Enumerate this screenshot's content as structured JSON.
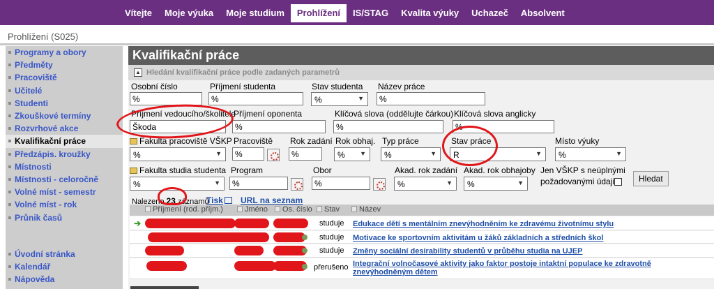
{
  "topnav": {
    "tabs": [
      "Vítejte",
      "Moje výuka",
      "Moje studium",
      "Prohlížení",
      "IS/STAG",
      "Kvalita výuky",
      "Uchazeč",
      "Absolvent"
    ],
    "active_index": 3
  },
  "page": {
    "title": "Prohlížení (S025)"
  },
  "sidebar": {
    "items": [
      "Programy a obory",
      "Předměty",
      "Pracoviště",
      "Učitelé",
      "Studenti",
      "Zkouškové termíny",
      "Rozvrhové akce",
      "Kvalifikační práce",
      "Předzápis. kroužky",
      "Místnosti",
      "Místnosti - celoročně",
      "Volné míst - semestr",
      "Volné míst - rok",
      "Průnik časů"
    ],
    "items_bottom": [
      "Úvodní stránka",
      "Kalendář",
      "Nápověda"
    ],
    "active_index": 7
  },
  "main": {
    "heading": "Kvalifikační práce",
    "subheading": "Hledání kvalifikační práce podle zadaných parametrů"
  },
  "form": {
    "osobni_cislo": {
      "label": "Osobní číslo",
      "value": "%"
    },
    "prijmeni_studenta": {
      "label": "Příjmení studenta",
      "value": "%"
    },
    "stav_studenta": {
      "label": "Stav studenta",
      "value": "%"
    },
    "nazev_prace": {
      "label": "Název práce",
      "value": "%"
    },
    "prijmeni_vedouciho": {
      "label": "Příjmení vedoucího/školitele",
      "value": "Škoda"
    },
    "prijmeni_oponenta": {
      "label": "Příjmení oponenta",
      "value": "%"
    },
    "klicova_slova": {
      "label": "Klíčová slova (oddělujte čárkou)",
      "value": "%"
    },
    "klicova_slova_en": {
      "label": "Klíčová slova anglicky",
      "value": "%"
    },
    "fakulta_pracoviste": {
      "label": "Fakulta pracoviště VŠKP",
      "value": "%"
    },
    "pracoviste": {
      "label": "Pracoviště",
      "value": "%"
    },
    "rok_zadani": {
      "label": "Rok zadání",
      "value": "%"
    },
    "rok_obhaj": {
      "label": "Rok obhaj.",
      "value": "%"
    },
    "typ_prace": {
      "label": "Typ práce",
      "value": "%"
    },
    "stav_prace": {
      "label": "Stav práce",
      "value": "R"
    },
    "misto_vyuky": {
      "label": "Místo výuky",
      "value": "%"
    },
    "fakulta_studia": {
      "label": "Fakulta studia studenta",
      "value": "%"
    },
    "program": {
      "label": "Program",
      "value": "%"
    },
    "obor": {
      "label": "Obor",
      "value": "%"
    },
    "akad_rok_zadani": {
      "label": "Akad. rok zadání",
      "value": "%"
    },
    "akad_rok_obhajoby": {
      "label": "Akad. rok obhajoby",
      "value": "%"
    },
    "jen_vskp": {
      "label_1": "Jen VŠKP s neúplnými",
      "label_2": "požadovanými údaji",
      "checked": false
    },
    "hledat_label": "Hledat"
  },
  "results": {
    "count_prefix": "Nalezeno",
    "count": "23",
    "count_suffix": "záznamů",
    "tisk_label": "Tisk",
    "url_label": "URL na seznam",
    "columns": [
      "Příjmení (rod. příjm.)",
      "Jméno",
      "Os. číslo",
      "Stav",
      "Název"
    ],
    "rows": [
      {
        "stav": "studuje",
        "nazev": "Edukace dětí s mentálním znevýhodněním ke zdravému životnímu stylu"
      },
      {
        "stav": "studuje",
        "nazev": "Motivace ke sportovním aktivitám u žáků základních a středních škol"
      },
      {
        "stav": "studuje",
        "nazev": "Změny sociální desirability studentů v průběhu studia na UJEP"
      },
      {
        "stav": "přerušeno",
        "nazev": "Integrační volnočasové aktivity jako faktor postoje intaktní populace ke zdravotně znevýhodněným dětem"
      }
    ]
  },
  "colors": {
    "brand": "#6b2f82",
    "link": "#1f4fa8",
    "annotation": "#e0161a"
  }
}
